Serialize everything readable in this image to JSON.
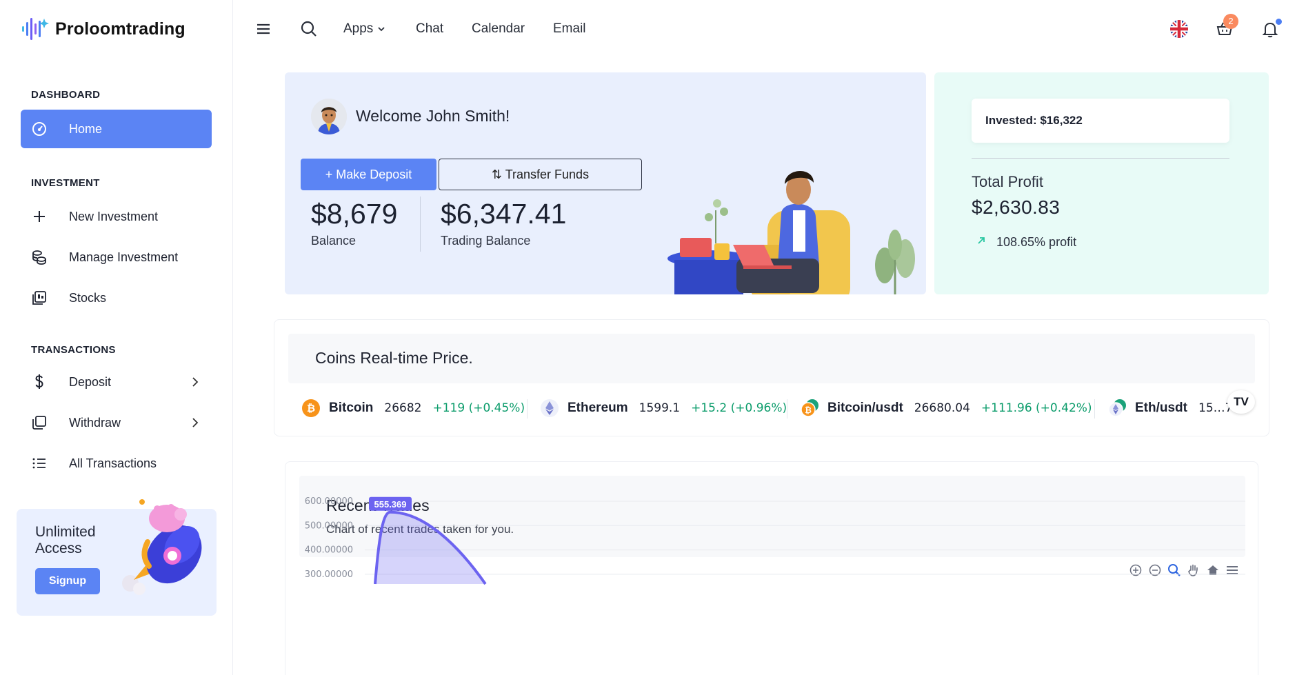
{
  "app": {
    "name": "Proloomtrading"
  },
  "sidebar": {
    "sections": [
      {
        "title": "DASHBOARD"
      },
      {
        "title": "INVESTMENT"
      },
      {
        "title": "TRANSACTIONS"
      }
    ],
    "items": [
      {
        "label": "Home",
        "icon": "dashboard-gauge-icon",
        "active": true
      },
      {
        "label": "New Investment",
        "icon": "plus-icon"
      },
      {
        "label": "Manage Investment",
        "icon": "coins-stack-icon"
      },
      {
        "label": "Stocks",
        "icon": "stocks-icon"
      },
      {
        "label": "Deposit",
        "icon": "dollar-icon",
        "has_submenu": true
      },
      {
        "label": "Withdraw",
        "icon": "copy-cards-icon",
        "has_submenu": true
      },
      {
        "label": "All Transactions",
        "icon": "list-icon"
      }
    ],
    "promo": {
      "title": "Unlimited Access",
      "button": "Signup"
    }
  },
  "header": {
    "menu": [
      "Apps",
      "Chat",
      "Calendar",
      "Email"
    ],
    "cart_badge": "2",
    "icons": [
      "hamburger-icon",
      "search-icon",
      "uk-flag-icon",
      "basket-icon",
      "bell-icon"
    ]
  },
  "welcome": {
    "title": "Welcome John Smith!",
    "deposit_button": "+ Make Deposit",
    "transfer_button": "Transfer Funds",
    "balance_value": "$8,679",
    "balance_label": "Balance",
    "trading_value": "$6,347.41",
    "trading_label": "Trading Balance"
  },
  "profit": {
    "invested": "Invested: $16,322",
    "label": "Total Profit",
    "value": "$2,630.83",
    "percent": "108.65% profit",
    "accent": "#26c6a0"
  },
  "coins": {
    "title": "Coins Real-time Price.",
    "ticker": [
      {
        "name": "Bitcoin",
        "price": "26682",
        "change": "+119 (+0.45%)",
        "icon": "bitcoin-icon"
      },
      {
        "name": "Ethereum",
        "price": "1599.1",
        "change": "+15.2 (+0.96%)",
        "icon": "ethereum-icon"
      },
      {
        "name": "Bitcoin/usdt",
        "price": "26680.04",
        "change": "+111.96 (+0.42%)",
        "icon": "bitcoin-tether-icon"
      },
      {
        "name": "Eth/usdt",
        "price": "15…7",
        "change": "",
        "icon": "ethereum-tether-icon"
      }
    ],
    "change_color": "#0b9c6b"
  },
  "trades": {
    "title": "Recent Trades",
    "subtitle": "Chart of recent trades taken for you.",
    "tools": [
      "zoom-in-icon",
      "zoom-out-icon",
      "zoom-select-icon",
      "pan-hand-icon",
      "home-reset-icon",
      "menu-icon"
    ]
  },
  "chart_data": {
    "type": "area",
    "title": "",
    "xlabel": "",
    "ylabel": "",
    "ylim": [
      300,
      600
    ],
    "yticks": [
      "600.00000",
      "500.00000",
      "400.00000",
      "300.00000"
    ],
    "series": [
      {
        "x": [
          0,
          1,
          2
        ],
        "values": [
          0,
          555.369,
          300
        ]
      }
    ],
    "peak_label": "555.369",
    "color": "#6c63f0"
  }
}
